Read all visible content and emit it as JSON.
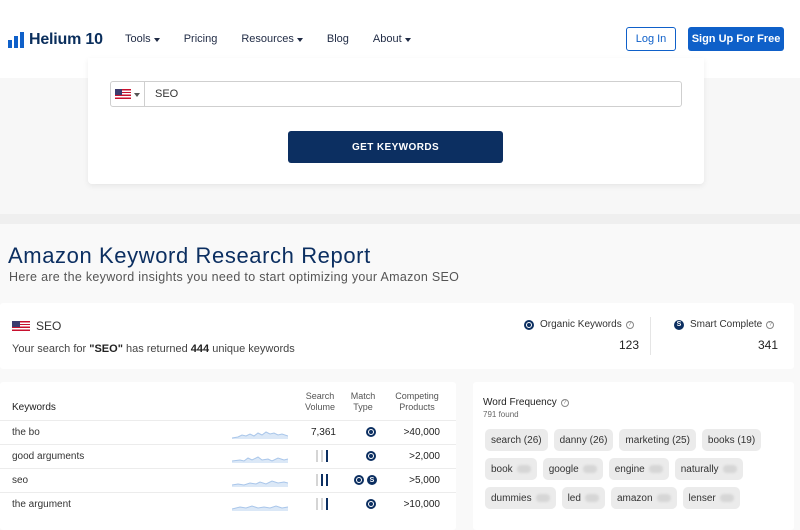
{
  "nav": {
    "logo": "Helium 10",
    "menu": [
      {
        "label": "Tools",
        "dropdown": true
      },
      {
        "label": "Pricing",
        "dropdown": false
      },
      {
        "label": "Resources",
        "dropdown": true
      },
      {
        "label": "Blog",
        "dropdown": false
      },
      {
        "label": "About",
        "dropdown": true
      }
    ],
    "login": "Log In",
    "signup": "Sign Up For Free"
  },
  "search": {
    "marketplace_icon": "us-flag-icon",
    "value": "SEO",
    "button": "GET KEYWORDS"
  },
  "report": {
    "title": "Amazon Keyword Research Report",
    "subtitle": "Here are the keyword insights you need to start optimizing your Amazon SEO"
  },
  "summary": {
    "keyword": "SEO",
    "text_prefix": "Your search for ",
    "text_keyword": "\"SEO\"",
    "text_mid": " has returned ",
    "count": "444",
    "text_suffix": " unique keywords",
    "organic_label": "Organic Keywords",
    "organic_value": "123",
    "smart_label": "Smart Complete",
    "smart_value": "341"
  },
  "table": {
    "headers": {
      "keywords": "Keywords",
      "volume_1": "Search",
      "volume_2": "Volume",
      "match_1": "Match",
      "match_2": "Type",
      "comp_1": "Competing",
      "comp_2": "Products"
    },
    "rows": [
      {
        "keyword": "the bo",
        "volume": "7,361",
        "match": [
          "organic"
        ],
        "competing": ">40,000"
      },
      {
        "keyword": "good arguments",
        "volume": "",
        "volume_bars": 1,
        "match": [
          "organic"
        ],
        "competing": ">2,000"
      },
      {
        "keyword": "seo",
        "volume": "",
        "volume_bars": 2,
        "match": [
          "organic",
          "smart"
        ],
        "competing": ">5,000"
      },
      {
        "keyword": "the argument",
        "volume": "",
        "volume_bars": 1,
        "match": [
          "organic"
        ],
        "competing": ">10,000"
      }
    ]
  },
  "word_frequency": {
    "title": "Word Frequency",
    "found": "791 found",
    "chips": [
      {
        "word": "search",
        "count": "(26)"
      },
      {
        "word": "danny",
        "count": "(26)"
      },
      {
        "word": "marketing",
        "count": "(25)"
      },
      {
        "word": "books",
        "count": "(19)"
      },
      {
        "word": "book",
        "count": ""
      },
      {
        "word": "google",
        "count": ""
      },
      {
        "word": "engine",
        "count": ""
      },
      {
        "word": "naturally",
        "count": ""
      },
      {
        "word": "dummies",
        "count": ""
      },
      {
        "word": "led",
        "count": ""
      },
      {
        "word": "amazon",
        "count": ""
      },
      {
        "word": "lenser",
        "count": ""
      }
    ]
  },
  "colors": {
    "brand_blue": "#0f60c9",
    "navy": "#0c2f61"
  }
}
